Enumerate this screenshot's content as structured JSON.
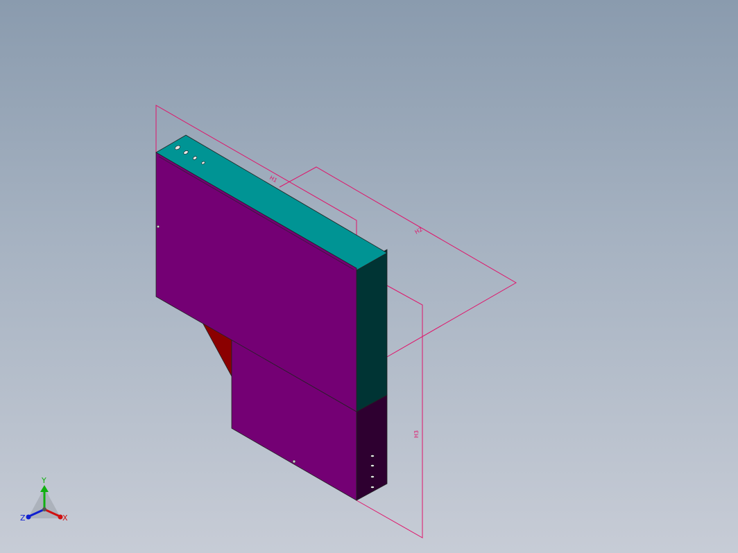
{
  "viewport": {
    "background_top": "#8a9bae",
    "background_bottom": "#c7ccd6"
  },
  "model": {
    "face_color": "#740074",
    "top_color": "#009494",
    "side_dark_color": "#003434",
    "side_purple_dark": "#2e0030",
    "bracket_color": "#8b0000",
    "dimension_color": "#e0136a"
  },
  "dimensions": {
    "d1": "H1",
    "d2": "H2",
    "d3": "H3"
  },
  "triad": {
    "x_label": "X",
    "y_label": "Y",
    "z_label": "Z",
    "x_color": "#d01010",
    "y_color": "#10b010",
    "z_color": "#1020d0"
  }
}
